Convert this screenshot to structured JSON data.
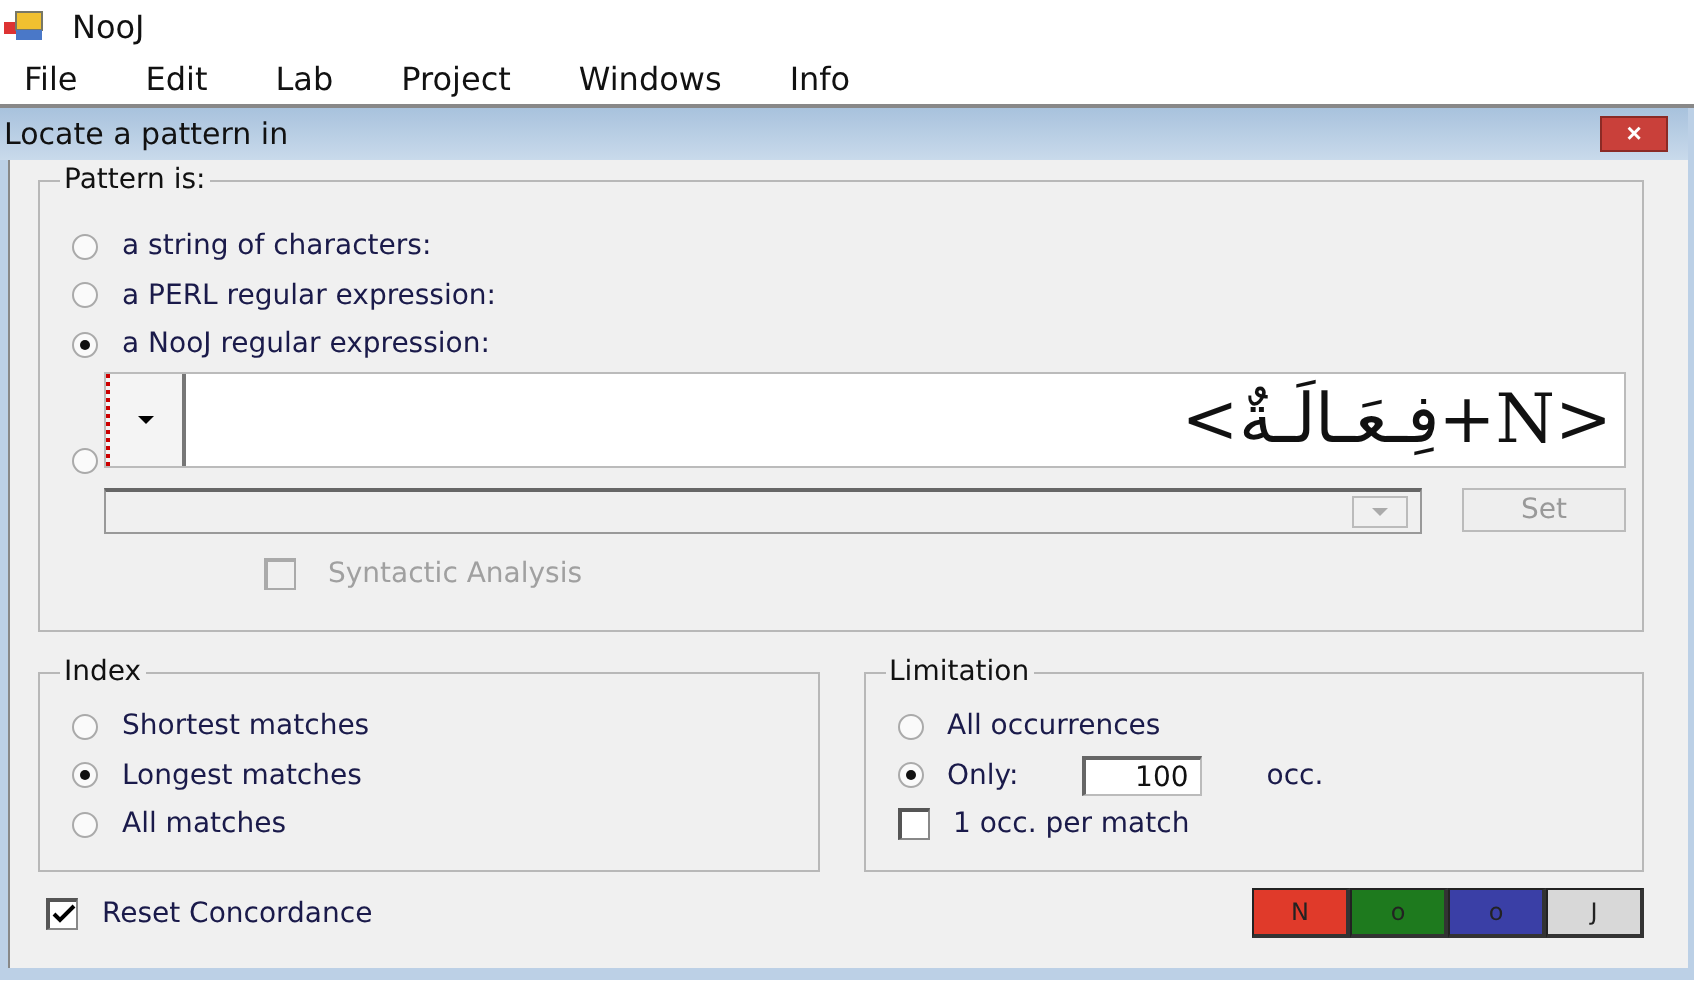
{
  "app": {
    "title": "NooJ",
    "menu": [
      "File",
      "Edit",
      "Lab",
      "Project",
      "Windows",
      "Info"
    ]
  },
  "dialog": {
    "title": "Locate a pattern in",
    "close": "×"
  },
  "pattern": {
    "legend": "Pattern is:",
    "options": [
      {
        "label": "a string of characters:",
        "selected": false
      },
      {
        "label": "a PERL regular expression:",
        "selected": false
      },
      {
        "label": "a NooJ regular expression:",
        "selected": true
      },
      {
        "selected": false
      }
    ],
    "expression": "<فِـعَـالَـةٌ+N>",
    "set_button": "Set",
    "syntactic": {
      "label": "Syntactic Analysis",
      "checked": false,
      "disabled": true
    }
  },
  "index": {
    "legend": "Index",
    "options": [
      {
        "label": "Shortest matches",
        "selected": false
      },
      {
        "label": "Longest matches",
        "selected": true
      },
      {
        "label": "All matches",
        "selected": false
      }
    ]
  },
  "limitation": {
    "legend": "Limitation",
    "options": [
      {
        "label": "All occurrences",
        "selected": false
      },
      {
        "label": "Only:",
        "selected": true
      }
    ],
    "count": "100",
    "unit": "occ.",
    "per_match": {
      "label": "1 occ. per match",
      "checked": false
    }
  },
  "reset": {
    "label": "Reset Concordance",
    "checked": true
  },
  "color_buttons": [
    {
      "label": "N",
      "color": "#e03a2a"
    },
    {
      "label": "o",
      "color": "#1e7a1e"
    },
    {
      "label": "o",
      "color": "#3a3fa6"
    },
    {
      "label": "J",
      "color": "#d8d8d8"
    }
  ]
}
